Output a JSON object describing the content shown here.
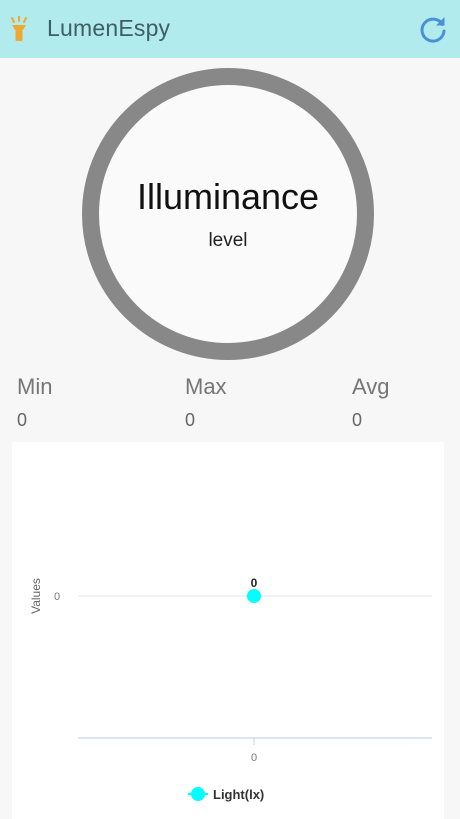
{
  "appbar": {
    "title": "LumenEspy",
    "icon": "flashlight-icon",
    "refresh_icon": "refresh-icon",
    "background": "#b2ebee",
    "accent": "#4a90d9"
  },
  "gauge": {
    "title": "Illuminance",
    "subtitle": "level",
    "ring_color": "#888888"
  },
  "stats": [
    {
      "label": "Min",
      "value": "0"
    },
    {
      "label": "Max",
      "value": "0"
    },
    {
      "label": "Avg",
      "value": "0"
    }
  ],
  "chart_data": {
    "type": "line",
    "ylabel": "Values",
    "xlabel": "",
    "x": [
      0
    ],
    "y_ticks": [
      "0"
    ],
    "x_ticks": [
      "0"
    ],
    "series": [
      {
        "name": "Light(lx)",
        "values": [
          0
        ],
        "color": "#00ffff",
        "data_labels": [
          "0"
        ]
      }
    ],
    "legend": "bottom-center",
    "grid": true
  }
}
